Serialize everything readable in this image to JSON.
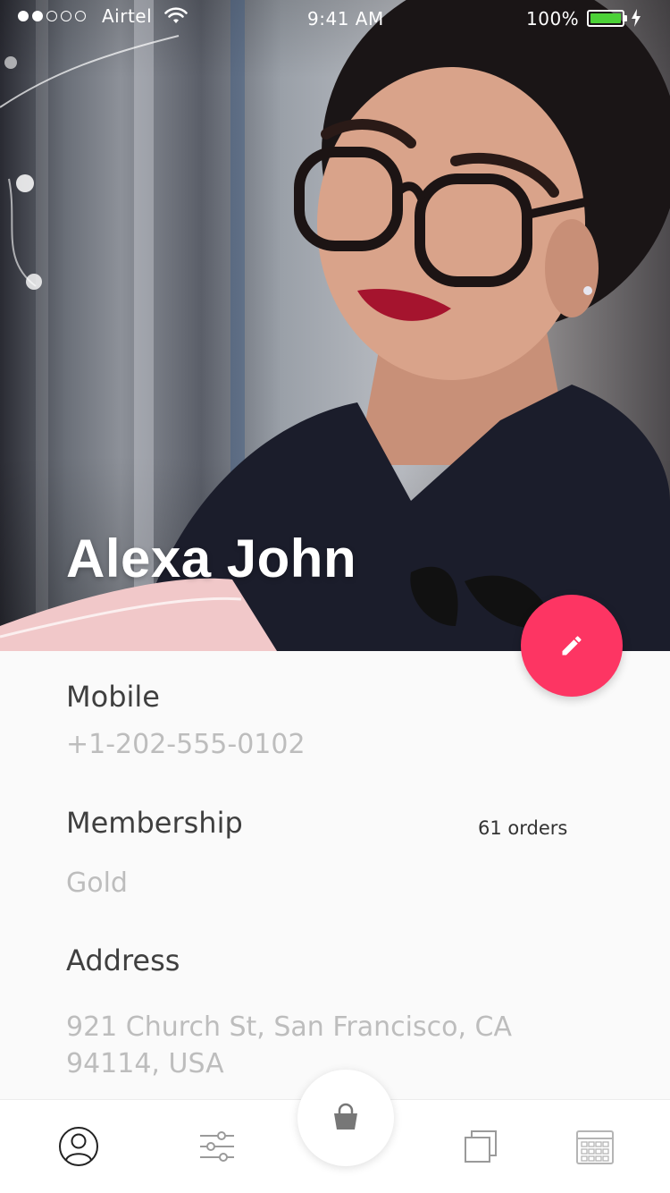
{
  "status_bar": {
    "carrier": "Airtel",
    "time": "9:41 AM",
    "battery": "100%",
    "signal_strength": 2,
    "signal_max": 5
  },
  "profile": {
    "name": "Alexa John"
  },
  "details": {
    "mobile_label": "Mobile",
    "mobile_value": "+1-202-555-0102",
    "membership_label": "Membership",
    "membership_value": "Gold",
    "orders": "61 orders",
    "address_label": "Address",
    "address_line1": "921 Church St, San Francisco, CA",
    "address_line2": "94114, USA"
  },
  "colors": {
    "accent": "#fd3563",
    "label": "#3f3f3f",
    "muted": "#bdbdbd"
  },
  "icons": {
    "edit": "pencil-icon",
    "tabs": [
      "user-icon",
      "sliders-icon",
      "shopping-bag-icon",
      "copy-icon",
      "calendar-icon"
    ]
  }
}
